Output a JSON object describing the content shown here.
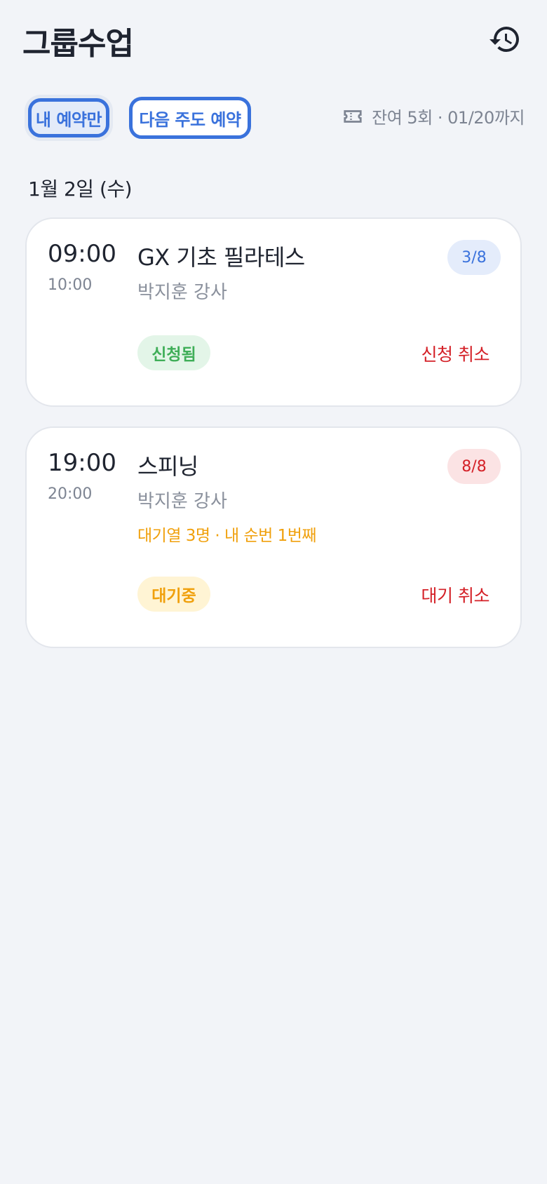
{
  "header": {
    "title": "그룹수업",
    "history_icon": "history-icon"
  },
  "filters": {
    "my_reservations_label": "내 예약만",
    "next_week_label": "다음 주도 예약"
  },
  "ticket": {
    "icon": "ticket-icon",
    "remaining_text": "잔여 5회 · 01/20까지"
  },
  "date_label": "1월 2일 (수)",
  "classes": [
    {
      "start": "09:00",
      "end": "10:00",
      "name": "GX 기초 필라테스",
      "instructor": "박지훈 강사",
      "capacity": "3/8",
      "status": "신청됨",
      "action": "신청 취소"
    },
    {
      "start": "19:00",
      "end": "20:00",
      "name": "스피닝",
      "instructor": "박지훈 강사",
      "waitlist": "대기열 3명 · 내 순번 1번째",
      "capacity": "8/8",
      "status": "대기중",
      "action": "대기 취소"
    }
  ],
  "colors": {
    "accent": "#3a72dc",
    "danger": "#d42027",
    "success": "#3fae58",
    "warning": "#f0a00c",
    "background": "#f2f4f8"
  }
}
